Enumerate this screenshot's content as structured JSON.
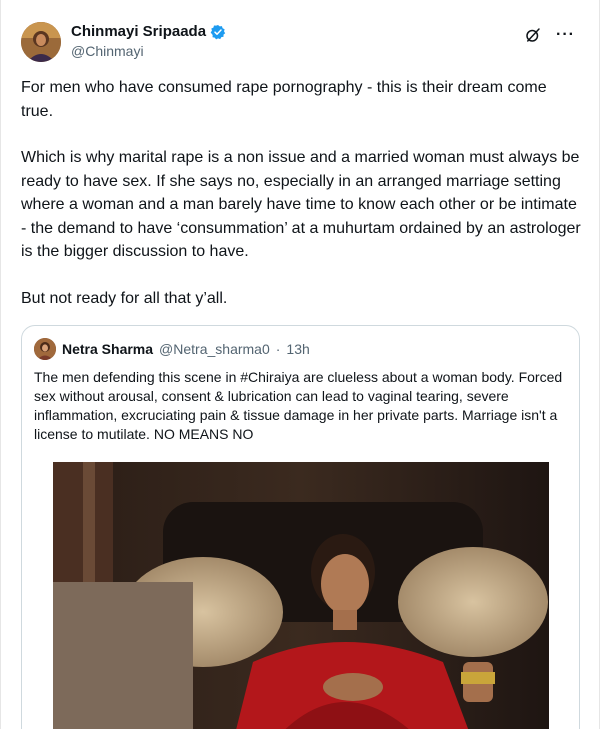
{
  "tweet": {
    "author": {
      "display_name": "Chinmayi Sripaada",
      "handle": "@Chinmayi",
      "verified": true,
      "avatar_icon": "profile-photo"
    },
    "actions": {
      "grok_icon": "grok-icon",
      "more_label": "···"
    },
    "paragraphs": [
      "For men who have consumed rape pornography - this is their dream come true.",
      "Which is why marital rape is a non issue and a married woman must always be ready to have sex. If she says no, especially in an arranged marriage setting where a woman and a man barely have time to know each other or be intimate - the demand to have ‘consummation’ at a muhurtam ordained by an astrologer is the bigger discussion to have.",
      "But not ready for all that y’all."
    ]
  },
  "quoted": {
    "display_name": "Netra Sharma",
    "handle": "@Netra_sharma0",
    "separator": "·",
    "time": "13h",
    "text": "The men defending this scene in #Chiraiya are clueless about a woman body. Forced sex without arousal, consent & lubrication can lead to vaginal tearing, severe inflammation, excruciating pain & tissue damage in her private parts. Marriage isn't a license to mutilate. NO MEANS NO",
    "media": "film-still-image"
  },
  "colors": {
    "text": "#0f1419",
    "secondary": "#536471",
    "verified": "#1d9bf0",
    "border": "#cfd9de"
  }
}
